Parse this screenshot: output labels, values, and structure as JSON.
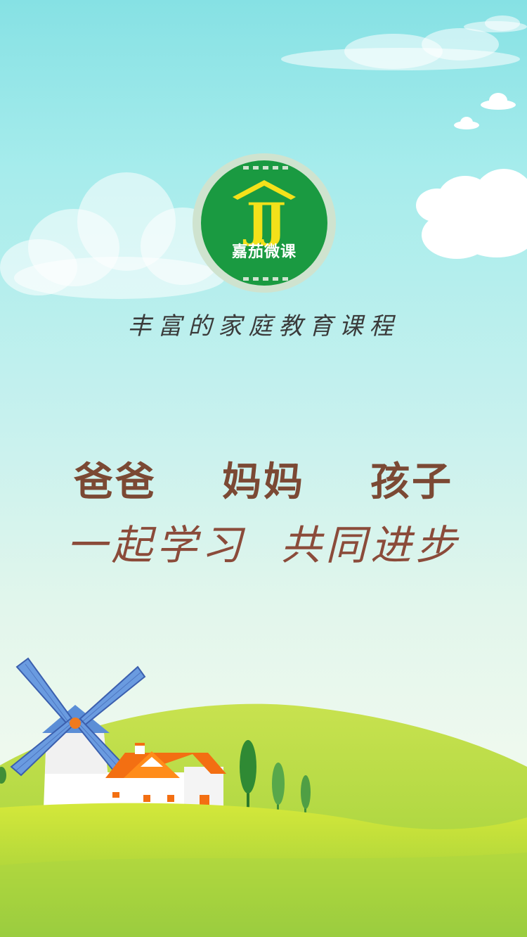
{
  "brand": {
    "logo_letters": "JJ",
    "name": "嘉茄微课",
    "colors": {
      "green": "#1a9a41",
      "yellow": "#f4e11a",
      "ring": "#cfe3cf"
    }
  },
  "slogan": "丰富的家庭教育课程",
  "tagline": {
    "family": "爸爸  妈妈  孩子",
    "motto": "一起学习  共同进步"
  },
  "scene": {
    "icons": [
      "cloud-icon",
      "windmill-icon",
      "house-icon",
      "tree-icon",
      "hill-icon"
    ]
  }
}
